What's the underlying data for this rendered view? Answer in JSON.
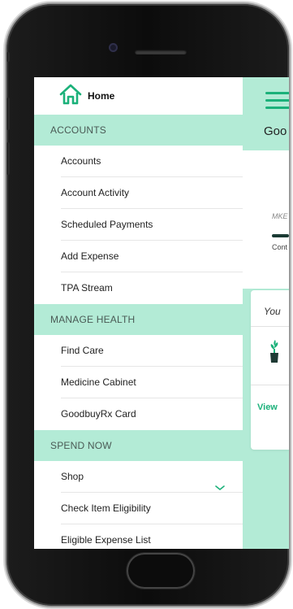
{
  "menu": {
    "home": "Home",
    "sections": [
      {
        "title": "ACCOUNTS",
        "items": [
          "Accounts",
          "Account Activity",
          "Scheduled Payments",
          "Add Expense",
          "TPA Stream"
        ]
      },
      {
        "title": "MANAGE HEALTH",
        "items": [
          "Find Care",
          "Medicine Cabinet",
          "GoodbuyRx Card"
        ]
      },
      {
        "title": "SPEND NOW",
        "items": [
          "Shop",
          "Check Item Eligibility",
          "Eligible Expense List"
        ]
      }
    ]
  },
  "background_app": {
    "title_fragment": "Goo",
    "label_fragment": "MKE",
    "caption_fragment": "Cont",
    "card_heading_fragment": "You",
    "link_fragment": "View"
  },
  "icons": {
    "home": "home-icon",
    "hamburger": "hamburger-icon",
    "shop_expand": "chevron-down-icon",
    "plant": "plant-icon"
  },
  "colors": {
    "accent": "#1bb17a",
    "section_bg": "#b3ebd6",
    "text": "#222222"
  }
}
